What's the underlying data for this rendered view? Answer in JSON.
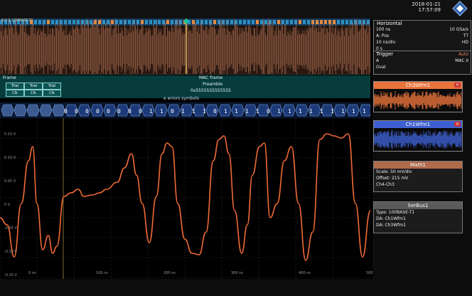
{
  "header": {
    "date": "2018-01-21",
    "time": "17:57:09"
  },
  "overview": {
    "label": "S:0 1 100BASE-T1"
  },
  "decode": {
    "frame_label": "Frame",
    "second_label": "MAC frame",
    "preamble_label": "Preamble",
    "preamble_value": "0x5555555555555",
    "cells_top": [
      "Trial",
      "Trial",
      "Trial"
    ],
    "cells_bottom": [
      "Clk",
      "Clk",
      "Clk"
    ],
    "bits_label": "e errors symbols",
    "bits": [
      "0",
      "0",
      "0",
      "0",
      "0",
      "0",
      "0",
      "0",
      "1",
      "1",
      "0",
      "1",
      "1",
      "1",
      "0",
      "1",
      "1",
      "1",
      "1",
      "0",
      "1",
      "1",
      "1",
      "1",
      "1",
      "1",
      "1",
      "1",
      "1"
    ]
  },
  "plot": {
    "y_labels": [
      "0.15 V",
      "0.10 V",
      "0.05 V",
      "0 V",
      "-0.05 V",
      "-0.10 V",
      "-0.15 V"
    ],
    "x_labels": [
      "0 ns",
      "100 ns",
      "200 ns",
      "300 ns",
      "400 ns",
      "500 ns"
    ]
  },
  "horizontal": {
    "title": "Horizontal",
    "rows": [
      [
        "100 ns",
        "10 GSa/s"
      ],
      [
        "A: Pos",
        "TT"
      ],
      [
        "10 ns/div",
        "HD"
      ],
      [
        "0 s",
        ""
      ]
    ]
  },
  "trigger": {
    "title": "Trigger",
    "mode": "Auto",
    "rows": [
      [
        "A",
        "MAC  II"
      ],
      [
        "Oval",
        ""
      ]
    ]
  },
  "widgets": [
    {
      "title": "Ch3Wfm1",
      "color": "#e8743c"
    },
    {
      "title": "Ch1Wfm1",
      "color": "#3d5fd1"
    }
  ],
  "math": {
    "title": "Math1",
    "lines": [
      "Scale: 50 mV/div",
      "Offset: 215 mV",
      "Ch4-Ch3"
    ]
  },
  "serbus": {
    "title": "SerBus1",
    "lines": [
      "Type: 100BASE-T1",
      "DA: Ch1Wfm1",
      "DA: Ch3Wfm1"
    ]
  },
  "colors": {
    "trace": "#f06a35",
    "cursor": "#e0c060",
    "bus": "#17a2b8"
  }
}
